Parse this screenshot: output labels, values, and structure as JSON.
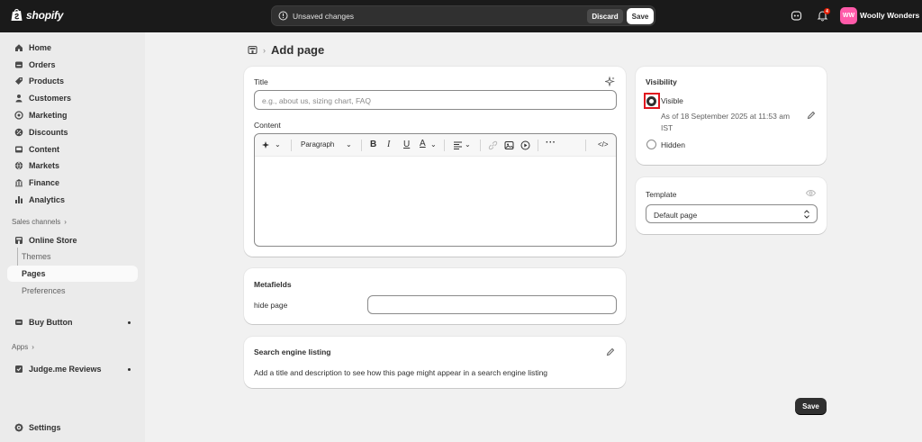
{
  "topbar": {
    "brand": "shopify",
    "unsaved_text": "Unsaved changes",
    "discard_label": "Discard",
    "save_label": "Save",
    "notification_count": "4",
    "avatar_initials": "WW",
    "store_name": "Woolly Wonders"
  },
  "sidebar": {
    "items": [
      {
        "label": "Home",
        "icon": "home-icon"
      },
      {
        "label": "Orders",
        "icon": "orders-icon"
      },
      {
        "label": "Products",
        "icon": "products-icon"
      },
      {
        "label": "Customers",
        "icon": "customers-icon"
      },
      {
        "label": "Marketing",
        "icon": "marketing-icon"
      },
      {
        "label": "Discounts",
        "icon": "discounts-icon"
      },
      {
        "label": "Content",
        "icon": "content-icon"
      },
      {
        "label": "Markets",
        "icon": "markets-icon"
      },
      {
        "label": "Finance",
        "icon": "finance-icon"
      },
      {
        "label": "Analytics",
        "icon": "analytics-icon"
      }
    ],
    "sales_channels_label": "Sales channels",
    "online_store": "Online Store",
    "themes": "Themes",
    "pages": "Pages",
    "preferences": "Preferences",
    "buy_button": "Buy Button",
    "apps_label": "Apps",
    "judge_me": "Judge.me Reviews",
    "settings": "Settings"
  },
  "page": {
    "title": "Add page"
  },
  "form": {
    "title_label": "Title",
    "title_placeholder": "e.g., about us, sizing chart, FAQ",
    "content_label": "Content",
    "paragraph_label": "Paragraph"
  },
  "metafields": {
    "heading": "Metafields",
    "hide_page_label": "hide page",
    "hide_page_value": ""
  },
  "seo": {
    "heading": "Search engine listing",
    "description": "Add a title and description to see how this page might appear in a search engine listing"
  },
  "visibility": {
    "heading": "Visibility",
    "visible_label": "Visible",
    "visible_note_line1": "As of 18 September 2025 at 11:53 am",
    "visible_note_line2": "IST",
    "hidden_label": "Hidden",
    "selected": "Visible"
  },
  "template": {
    "heading": "Template",
    "selected": "Default page"
  },
  "footer": {
    "save_label": "Save"
  },
  "colors": {
    "topbar": "#1a1a1a",
    "primary_button": "#303030",
    "avatar": "#ff5aa9",
    "highlight": "#e0141e"
  }
}
